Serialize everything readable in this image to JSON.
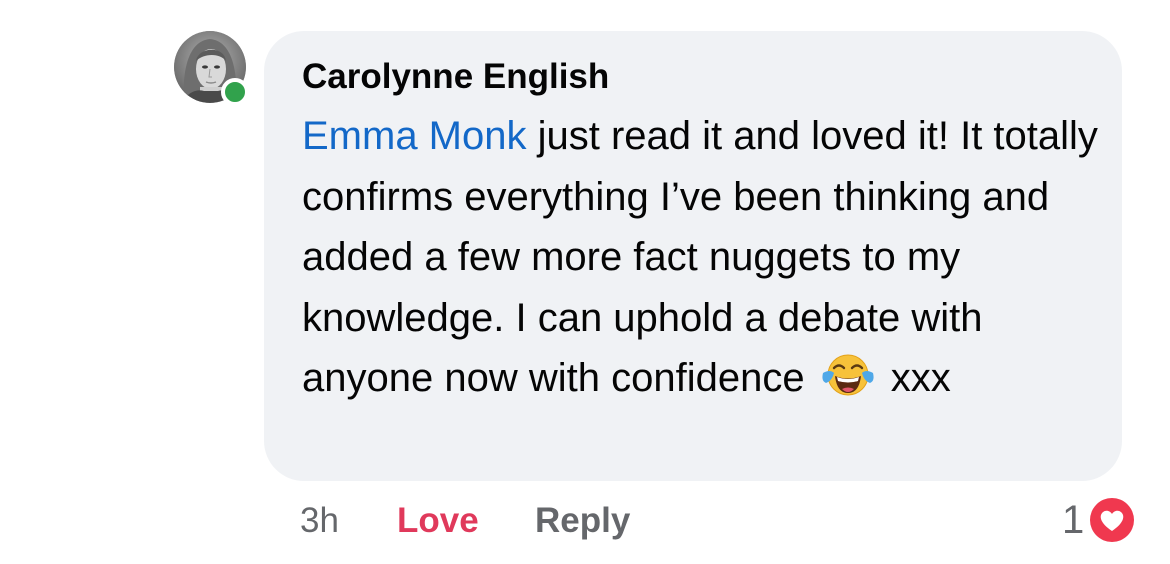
{
  "comment": {
    "author": "Carolynne English",
    "mention": "Emma Monk",
    "text_before_emoji": " just read it and loved it! It totally confirms everything I’ve been thinking and added a few more fact nuggets to my knowledge. I can uphold a debate with anyone now with confidence ",
    "emoji": "face-with-tears-of-joy",
    "text_after_emoji": " xxx",
    "online": true
  },
  "actions": {
    "time": "3h",
    "love_label": "Love",
    "reply_label": "Reply"
  },
  "reactions": {
    "count": "1",
    "type": "love-heart"
  },
  "colors": {
    "bubble": "#f0f2f5",
    "mention": "#1368c8",
    "love": "#e0395b",
    "muted": "#65676b",
    "online": "#31a24c"
  }
}
